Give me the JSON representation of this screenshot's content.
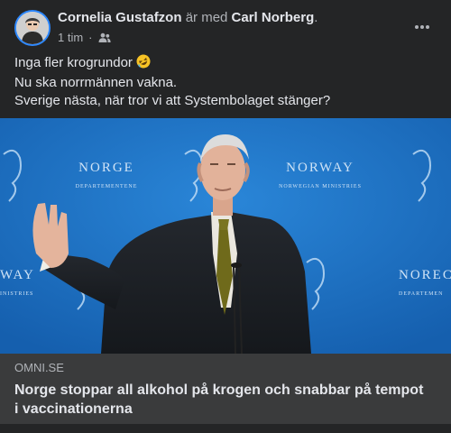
{
  "post": {
    "author": "Cornelia Gustafzon",
    "with_text": "är med",
    "tagged": "Carl Norberg",
    "end_punct": ".",
    "time": "1 tim",
    "separator": "·",
    "privacy_icon": "friends-icon",
    "more_icon": "more-options-icon",
    "text_lines": [
      "Inga fler krogrundor",
      "Nu ska norrmännen vakna.",
      "Sverige nästa, när tror vi att Systembolaget stänger?"
    ],
    "emoji": "rolling-on-floor-laughing-emoji"
  },
  "link_preview": {
    "domain": "OMNI.SE",
    "headline": "Norge stoppar all alkohol på krogen och snabbar på tempot i vaccinationerna",
    "backdrop_text": {
      "norge": "NORGE",
      "departementene": "DEPARTEMENTENE",
      "norway": "NORWAY",
      "norwegian_ministries": "NORWEGIAN MINISTRIES",
      "way": "WAY",
      "inistries": "INISTRIES",
      "norec": "NOREC",
      "departemen": "DEPARTEMEN"
    }
  },
  "colors": {
    "background": "#242526",
    "link_footer": "#3a3b3c",
    "image_blue": "#1e6fc0",
    "text": "#e4e6eb",
    "muted": "#b0b3b8",
    "avatar_ring": "#2d88ff"
  }
}
